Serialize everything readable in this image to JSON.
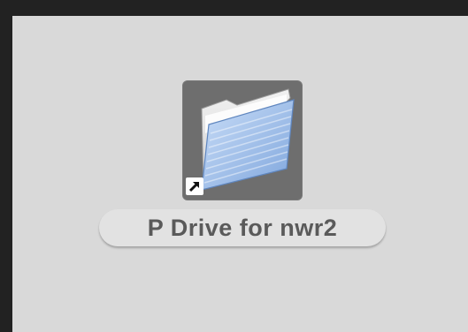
{
  "desktop": {
    "background_color": "#d9d9d9",
    "item": {
      "name": "P Drive for nwr2",
      "icon": "folder-alias-icon",
      "badge_icon": "alias-arrow-icon",
      "selected": true
    }
  }
}
